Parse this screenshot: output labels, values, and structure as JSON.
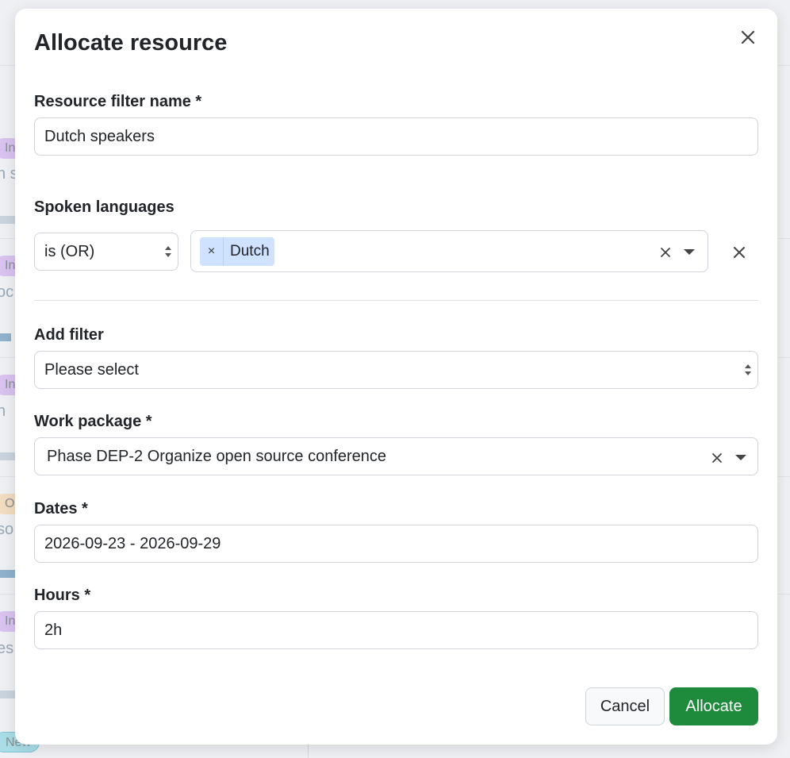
{
  "background": {
    "pills": [
      {
        "text": "In",
        "color": "#d9c2f0"
      },
      {
        "text": "In p",
        "color": "#d9c2f0"
      },
      {
        "text": "In p",
        "color": "#d9c2f0"
      },
      {
        "text": "On",
        "color": "#f2dcc0"
      },
      {
        "text": "In p",
        "color": "#d9c2f0"
      },
      {
        "text": "New",
        "color": "#a9dde8"
      }
    ],
    "fragments": [
      "n s",
      "oc",
      "n",
      "so",
      "es"
    ]
  },
  "modal": {
    "title": "Allocate resource",
    "close_icon": "close-icon",
    "filter_name": {
      "label": "Resource filter name *",
      "value": "Dutch speakers"
    },
    "spoken_languages": {
      "label": "Spoken languages",
      "operator": "is (OR)",
      "selected": [
        {
          "label": "Dutch",
          "remove": "×"
        }
      ],
      "clear_icon": "clear-icon",
      "dropdown_icon": "caret-down-icon",
      "remove_filter_icon": "close-icon"
    },
    "add_filter": {
      "label": "Add filter",
      "placeholder": "Please select"
    },
    "work_package": {
      "label": "Work package *",
      "value": "Phase DEP-2 Organize open source conference"
    },
    "dates": {
      "label": "Dates *",
      "value": "2026-09-23 - 2026-09-29"
    },
    "hours": {
      "label": "Hours *",
      "value": "2h"
    },
    "buttons": {
      "cancel": "Cancel",
      "allocate": "Allocate"
    },
    "colors": {
      "chip_bg": "#cfe2ff",
      "primary_green": "#1e8a3c",
      "border": "#ced4da"
    }
  }
}
